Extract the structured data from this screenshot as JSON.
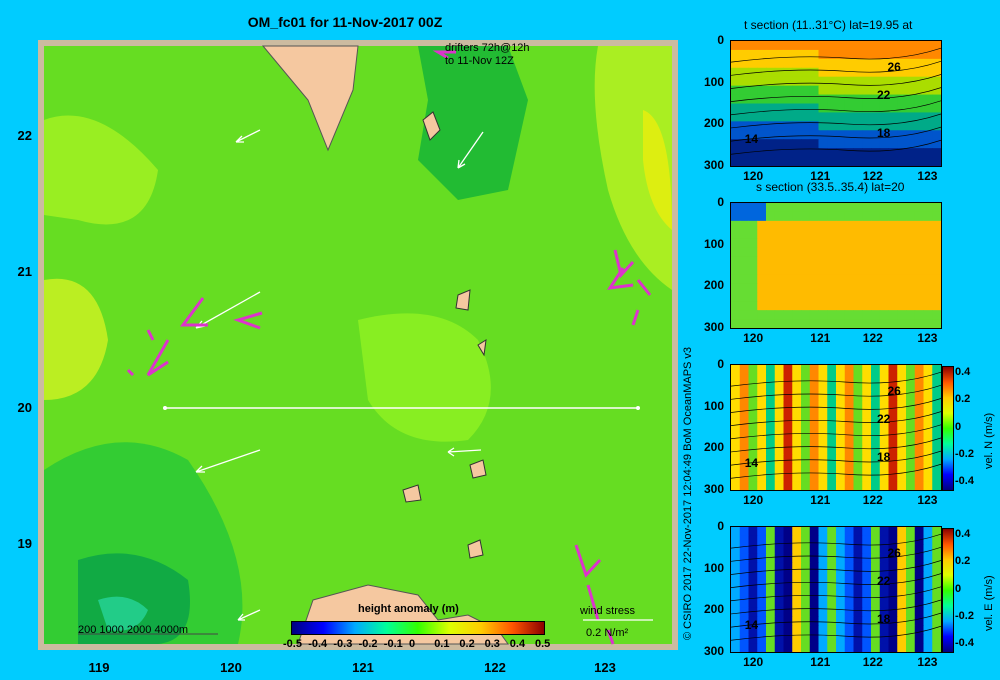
{
  "title": "OM_fc01 for 11-Nov-2017 00Z",
  "map": {
    "drifters_line1": "drifters 72h@12h",
    "drifters_line2": "to 11-Nov 12Z",
    "yticks": [
      "22",
      "21",
      "20",
      "19"
    ],
    "xticks": [
      "119",
      "120",
      "121",
      "122",
      "123"
    ],
    "scale_bar": "200  1000  2000  4000m",
    "colorbar_title": "height anomaly  (m)",
    "colorbar_ticks": [
      "-0.5",
      "-0.4",
      "-0.3",
      "-0.2",
      "-0.1",
      "0",
      "0.1",
      "0.2",
      "0.3",
      "0.4",
      "0.5"
    ],
    "wind_label": "wind stress",
    "wind_value": "0.2 N/m²",
    "copyright": "© CSIRO 2017   22-Nov-2017 12:04:49 BoM OceanMAPS v3"
  },
  "panels": [
    {
      "title": "t section (11..31°C) lat=19.95 at",
      "contours": [
        "26",
        "22",
        "18",
        "14"
      ],
      "colorbar": false
    },
    {
      "title": "s section (33.5..35.4) lat=20",
      "contours": [],
      "colorbar": false
    },
    {
      "title": "",
      "contours": [
        "26",
        "22",
        "18",
        "14"
      ],
      "colorbar": true,
      "cbar_label": "vel. N (m/s)",
      "cbar_ticks": [
        "0.4",
        "0.2",
        "0",
        "-0.2",
        "-0.4"
      ]
    },
    {
      "title": "",
      "contours": [
        "26",
        "22",
        "18",
        "14"
      ],
      "colorbar": true,
      "cbar_label": "vel. E (m/s)",
      "cbar_ticks": [
        "0.4",
        "0.2",
        "0",
        "-0.2",
        "-0.4"
      ]
    }
  ],
  "panel_axes": {
    "yticks": [
      "0",
      "100",
      "200",
      "300"
    ],
    "xticks": [
      "120",
      "121",
      "122",
      "123"
    ]
  },
  "chart_data": [
    {
      "type": "heatmap",
      "title": "OM_fc01 for 11-Nov-2017 00Z",
      "xlabel": "",
      "ylabel": "",
      "xlim": [
        118.5,
        123.5
      ],
      "ylim": [
        18.3,
        22.7
      ],
      "colorbar": {
        "label": "height anomaly (m)",
        "range": [
          -0.5,
          0.5
        ]
      },
      "section_line": {
        "lat": 20,
        "lon": [
          119.5,
          123.2
        ]
      }
    },
    {
      "type": "heatmap",
      "title": "t section (11..31°C) lat=19.95 at",
      "xlim": [
        119.6,
        123.2
      ],
      "ylim": [
        300,
        0
      ]
    },
    {
      "type": "heatmap",
      "title": "s section (33.5..35.4) lat=20",
      "xlim": [
        119.6,
        123.2
      ],
      "ylim": [
        300,
        0
      ]
    },
    {
      "type": "heatmap",
      "title": "",
      "ylabel": "vel. N (m/s)",
      "xlim": [
        119.6,
        123.2
      ],
      "ylim": [
        300,
        0
      ],
      "colorbar_range": [
        -0.4,
        0.4
      ]
    },
    {
      "type": "heatmap",
      "title": "",
      "ylabel": "vel. E (m/s)",
      "xlim": [
        119.6,
        123.2
      ],
      "ylim": [
        300,
        0
      ],
      "colorbar_range": [
        -0.4,
        0.4
      ]
    }
  ]
}
